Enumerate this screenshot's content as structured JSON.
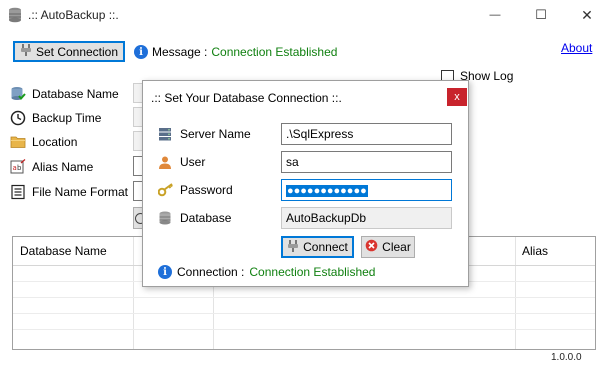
{
  "window": {
    "title": ".:: AutoBackup ::.",
    "minimize_glyph": "—",
    "maximize_glyph": "☐",
    "close_glyph": "✕"
  },
  "toolbar": {
    "set_connection_label": "Set Connection",
    "message_label": "Message :",
    "message_value": "Connection Established",
    "about_label": "About"
  },
  "show_log": {
    "label": "Show Log",
    "checked": false
  },
  "fields": [
    {
      "label": "Database Name",
      "icon": "database-check-icon"
    },
    {
      "label": "Backup Time",
      "icon": "clock-icon"
    },
    {
      "label": "Location",
      "icon": "folder-icon"
    },
    {
      "label": "Alias Name",
      "icon": "rename-icon"
    },
    {
      "label": "File Name Format",
      "icon": "list-icon"
    }
  ],
  "grid": {
    "columns": [
      "Database Name",
      "Alias"
    ]
  },
  "version": "1.0.0.0",
  "dialog": {
    "title": ".:: Set Your Database Connection ::.",
    "close_glyph": "x",
    "server_name_label": "Server Name",
    "server_name_value": ".\\SqlExpress",
    "user_label": "User",
    "user_value": "sa",
    "password_label": "Password",
    "password_value": "●●●●●●●●●●●●",
    "database_label": "Database",
    "database_value": "AutoBackupDb",
    "connect_label": "Connect",
    "clear_label": "Clear",
    "connection_label": "Connection :",
    "connection_value": "Connection Established"
  },
  "colors": {
    "accent": "#0078d7",
    "success": "#108010",
    "close_red": "#c8232c",
    "link": "#0000ee"
  }
}
